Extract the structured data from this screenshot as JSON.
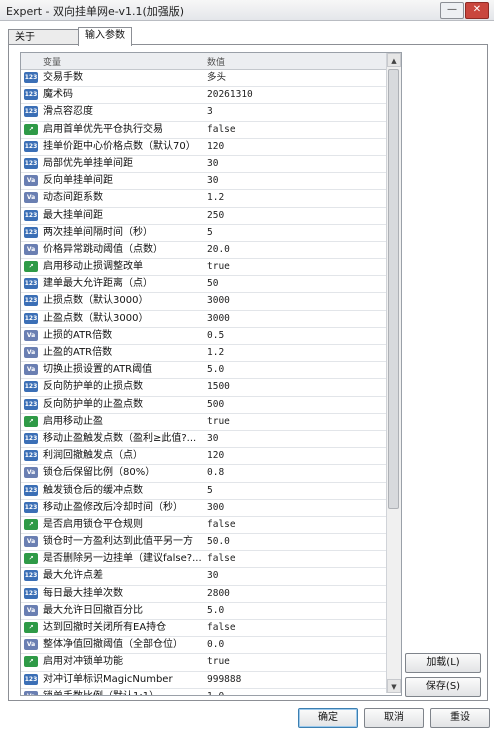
{
  "window": {
    "title": "Expert - 双向挂单网e-v1.1(加强版)",
    "minimize": "—",
    "close": "✕"
  },
  "tabs": [
    {
      "label": "关于"
    },
    {
      "label": "输入参数"
    }
  ],
  "table": {
    "col_name": "变量",
    "col_value": "数值",
    "rows": [
      {
        "icon": "123",
        "name": "交易手数",
        "value": "多头"
      },
      {
        "icon": "123",
        "name": "魔术码",
        "value": "20261310"
      },
      {
        "icon": "123",
        "name": "滑点容忍度",
        "value": "3"
      },
      {
        "icon": "bool",
        "name": "启用首单优先平仓执行交易",
        "value": "false"
      },
      {
        "icon": "123",
        "name": "挂单价距中心价格点数（默认70）",
        "value": "120"
      },
      {
        "icon": "123",
        "name": "局部优先单挂单间距",
        "value": "30"
      },
      {
        "icon": "val",
        "name": "反向单挂单间距",
        "value": "30"
      },
      {
        "icon": "val",
        "name": "动态间距系数",
        "value": "1.2"
      },
      {
        "icon": "123",
        "name": "最大挂单间距",
        "value": "250"
      },
      {
        "icon": "123",
        "name": "两次挂单间隔时间（秒）",
        "value": "5"
      },
      {
        "icon": "val",
        "name": "价格异常跳动阈值（点数）",
        "value": "20.0"
      },
      {
        "icon": "bool",
        "name": "启用移动止损调整改单",
        "value": "true"
      },
      {
        "icon": "123",
        "name": "建单最大允许距离（点）",
        "value": "50"
      },
      {
        "icon": "123",
        "name": "止损点数（默认3000）",
        "value": "3000"
      },
      {
        "icon": "123",
        "name": "止盈点数（默认3000）",
        "value": "3000"
      },
      {
        "icon": "val",
        "name": "止损的ATR倍数",
        "value": "0.5"
      },
      {
        "icon": "val",
        "name": "止盈的ATR倍数",
        "value": "1.2"
      },
      {
        "icon": "val",
        "name": "切换止损设置的ATR阈值",
        "value": "5.0"
      },
      {
        "icon": "123",
        "name": "反向防护单的止损点数",
        "value": "1500"
      },
      {
        "icon": "123",
        "name": "反向防护单的止盈点数",
        "value": "500"
      },
      {
        "icon": "bool",
        "name": "启用移动止盈",
        "value": "true"
      },
      {
        "icon": "123",
        "name": "移动止盈触发点数（盈利≥此值?...",
        "value": "30"
      },
      {
        "icon": "123",
        "name": "利润回撤触发点（点）",
        "value": "120"
      },
      {
        "icon": "val",
        "name": "锁仓后保留比例（80%）",
        "value": "0.8"
      },
      {
        "icon": "123",
        "name": "触发锁仓后的缓冲点数",
        "value": "5"
      },
      {
        "icon": "123",
        "name": "移动止盈修改后冷却时间（秒）",
        "value": "300"
      },
      {
        "icon": "bool",
        "name": "是否启用锁仓平仓规则",
        "value": "false"
      },
      {
        "icon": "val",
        "name": "锁仓时一方盈利达到此值平另一方",
        "value": "50.0"
      },
      {
        "icon": "bool",
        "name": "是否删除另一边挂单（建议false?...",
        "value": "false"
      },
      {
        "icon": "123",
        "name": "最大允许点差",
        "value": "30"
      },
      {
        "icon": "123",
        "name": "每日最大挂单次数",
        "value": "2800"
      },
      {
        "icon": "val",
        "name": "最大允许日回撤百分比",
        "value": "5.0"
      },
      {
        "icon": "bool",
        "name": "达到回撤时关闭所有EA持仓",
        "value": "false"
      },
      {
        "icon": "val",
        "name": "整体净值回撤阈值（全部仓位）",
        "value": "0.0"
      },
      {
        "icon": "bool",
        "name": "启用对冲锁单功能",
        "value": "true"
      },
      {
        "icon": "123",
        "name": "对冲订单标识MagicNumber",
        "value": "999888"
      },
      {
        "icon": "val",
        "name": "锁单手数比例（默认1:1）",
        "value": "1.0"
      },
      {
        "icon": "bool",
        "name": "在止损触发时自动平对冲单",
        "value": "false"
      }
    ]
  },
  "buttons": {
    "load": "加载(L)",
    "save": "保存(S)",
    "ok": "确定",
    "cancel": "取消",
    "reset": "重设"
  },
  "colors": {
    "int_icon": "#3b6fb6",
    "bool_icon": "#2e9a47",
    "val_icon": "#6a7fb2"
  }
}
